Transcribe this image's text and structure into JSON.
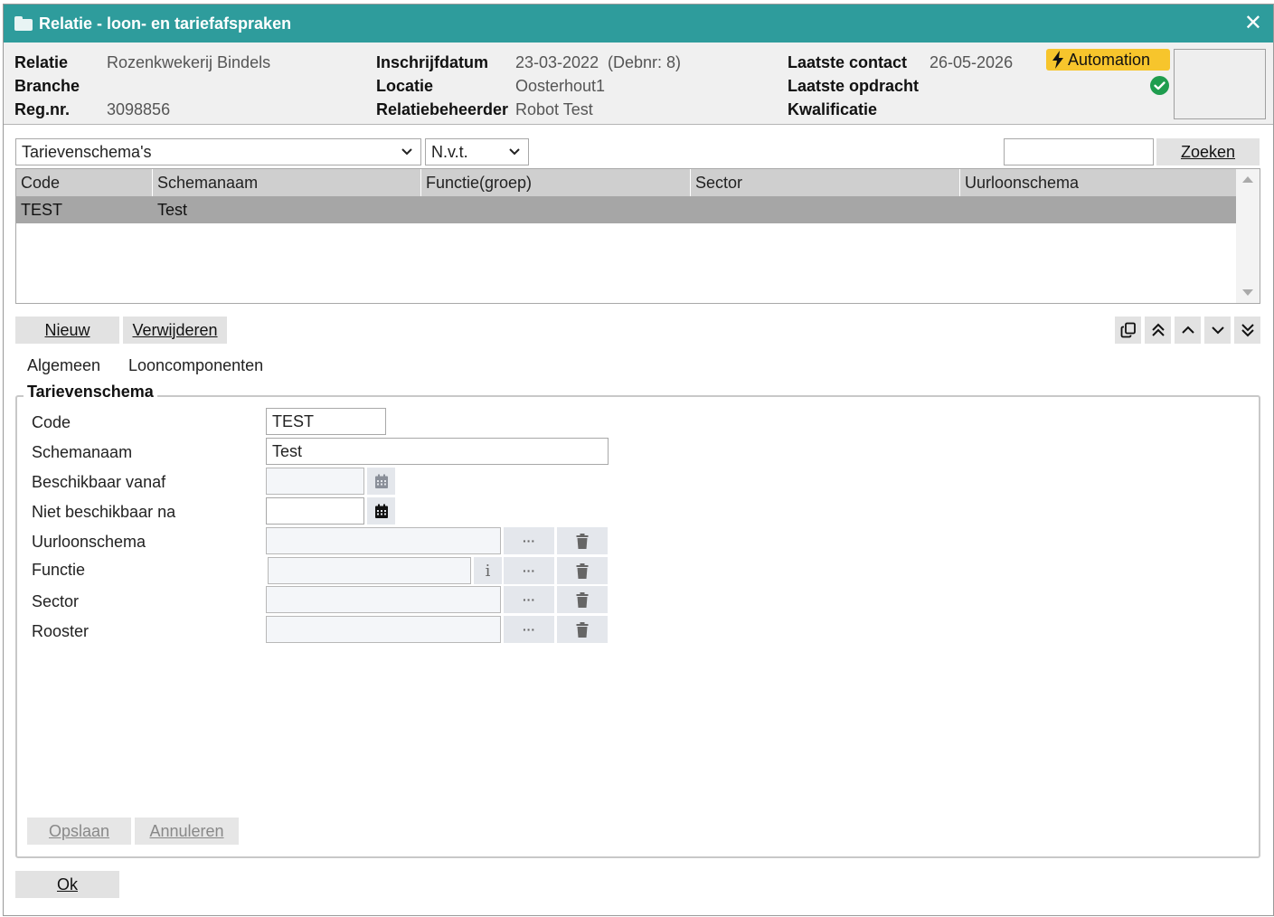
{
  "window": {
    "title": "Relatie - loon- en tariefafspraken",
    "close_glyph": "✕"
  },
  "header": {
    "relatie_label": "Relatie",
    "relatie_value": "Rozenkwekerij Bindels",
    "branche_label": "Branche",
    "regnr_label": "Reg.nr.",
    "regnr_value": "3098856",
    "inschrijf_label": "Inschrijfdatum",
    "inschrijf_value": "23-03-2022",
    "debnr": "(Debnr: 8)",
    "locatie_label": "Locatie",
    "locatie_value": "Oosterhout1",
    "beheerder_label": "Relatiebeheerder",
    "beheerder_value": "Robot Test",
    "contact_label": "Laatste contact",
    "contact_value": "26-05-2026",
    "opdracht_label": "Laatste opdracht",
    "kwalificatie_label": "Kwalificatie",
    "automation_badge": "Automation",
    "colors": {
      "titlebar": "#2e9c9c",
      "badge": "#f7c52c",
      "status_ok": "#1f9d4f"
    }
  },
  "filters": {
    "type_select": "Tarievenschema's",
    "nvt_select": "N.v.t.",
    "search_value": "",
    "search_button": "Zoeken"
  },
  "grid": {
    "columns": [
      "Code",
      "Schemanaam",
      "Functie(groep)",
      "Sector",
      "Uurloonschema"
    ],
    "rows": [
      {
        "code": "TEST",
        "schemanaam": "Test",
        "functie": "",
        "sector": "",
        "uurloonschema": ""
      }
    ]
  },
  "actions": {
    "new": "Nieuw",
    "delete": "Verwijderen"
  },
  "tabs": {
    "general": "Algemeen",
    "components": "Looncomponenten"
  },
  "form": {
    "legend": "Tarievenschema",
    "code_label": "Code",
    "code_value": "TEST",
    "name_label": "Schemanaam",
    "name_value": "Test",
    "from_label": "Beschikbaar vanaf",
    "from_value": "",
    "until_label": "Niet beschikbaar na",
    "until_value": "",
    "hourly_label": "Uurloonschema",
    "hourly_value": "",
    "function_label": "Functie",
    "function_value": "",
    "sector_label": "Sector",
    "sector_value": "",
    "roster_label": "Rooster",
    "roster_value": "",
    "dots": "···",
    "info": "i",
    "save": "Opslaan",
    "cancel": "Annuleren"
  },
  "footer": {
    "ok": "Ok"
  }
}
